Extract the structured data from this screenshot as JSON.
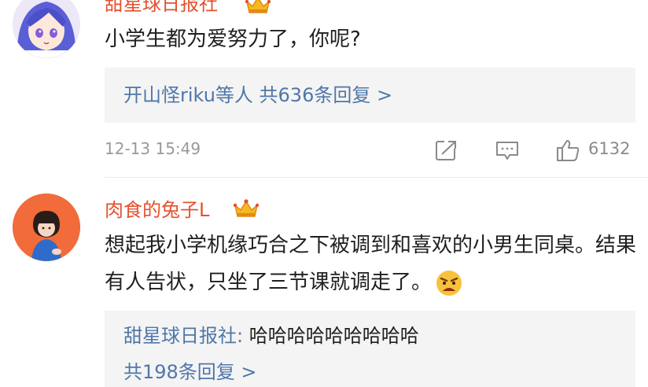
{
  "comment1": {
    "username": "甜星球日报社",
    "text": "小学生都为爱努力了，你呢?",
    "reply_summary": "开山怪riku等人  共636条回复 >",
    "timestamp": "12-13 15:49",
    "like_count": "6132"
  },
  "comment2": {
    "username": "肉食的兔子L",
    "text": "想起我小学机缘巧合之下被调到和喜欢的小男生同桌。结果有人告状，只坐了三节课就调走了。",
    "reply": {
      "author": "甜星球日报社:",
      "text": "哈哈哈哈哈哈哈哈哈",
      "count": "共198条回复 >"
    }
  },
  "colors": {
    "username": "#e5502e",
    "link": "#4f77a9",
    "reply_bg": "#f4f4f4",
    "meta": "#999999"
  },
  "icons": [
    "crown-badge-icon",
    "share-icon",
    "comment-icon",
    "like-icon",
    "angry-emoji-icon"
  ]
}
